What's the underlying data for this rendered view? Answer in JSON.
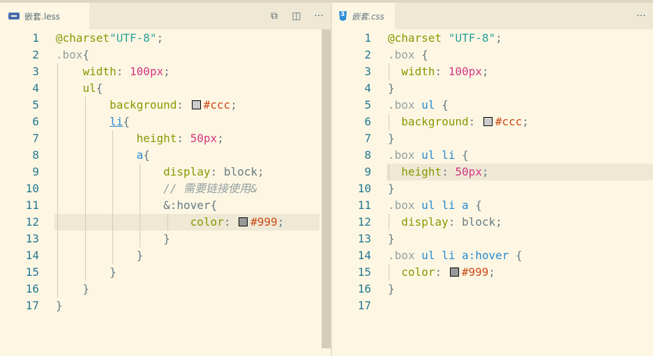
{
  "left_editor": {
    "tab_label": "嵌套.less",
    "actions": {
      "compare_icon": "⧉",
      "split_icon": "◫",
      "more_icon": "···"
    },
    "line_numbers": [
      "1",
      "2",
      "3",
      "4",
      "5",
      "6",
      "7",
      "8",
      "9",
      "10",
      "11",
      "12",
      "13",
      "14",
      "15",
      "16",
      "17"
    ],
    "lines": [
      [
        {
          "t": "@charset",
          "c": "at"
        },
        {
          "t": "\"UTF-8\"",
          "c": "str"
        },
        {
          "t": ";",
          "c": "plain"
        }
      ],
      [
        {
          "t": ".box",
          "c": "sel"
        },
        {
          "t": "{",
          "c": "plain"
        }
      ],
      [
        {
          "t": "    ",
          "c": "plain"
        },
        {
          "t": "width",
          "c": "prop"
        },
        {
          "t": ": ",
          "c": "plain"
        },
        {
          "t": "100px",
          "c": "num"
        },
        {
          "t": ";",
          "c": "plain"
        }
      ],
      [
        {
          "t": "    ",
          "c": "plain"
        },
        {
          "t": "ul",
          "c": "kw"
        },
        {
          "t": "{",
          "c": "plain"
        }
      ],
      [
        {
          "t": "        ",
          "c": "plain"
        },
        {
          "t": "background",
          "c": "prop"
        },
        {
          "t": ": ",
          "c": "plain"
        },
        {
          "t": "",
          "c": "swatch",
          "color": "#CCCCCC"
        },
        {
          "t": "#ccc",
          "c": "hash"
        },
        {
          "t": ";",
          "c": "plain"
        }
      ],
      [
        {
          "t": "        ",
          "c": "plain"
        },
        {
          "t": "li",
          "c": "ul"
        },
        {
          "t": "{",
          "c": "plain"
        }
      ],
      [
        {
          "t": "            ",
          "c": "plain"
        },
        {
          "t": "height",
          "c": "prop"
        },
        {
          "t": ": ",
          "c": "plain"
        },
        {
          "t": "50px",
          "c": "num"
        },
        {
          "t": ";",
          "c": "plain"
        }
      ],
      [
        {
          "t": "            ",
          "c": "plain"
        },
        {
          "t": "a",
          "c": "tag"
        },
        {
          "t": "{",
          "c": "plain"
        }
      ],
      [
        {
          "t": "                ",
          "c": "plain"
        },
        {
          "t": "display",
          "c": "prop"
        },
        {
          "t": ": ",
          "c": "plain"
        },
        {
          "t": "block",
          "c": "plain"
        },
        {
          "t": ";",
          "c": "plain"
        }
      ],
      [
        {
          "t": "                ",
          "c": "plain"
        },
        {
          "t": "// 需要链接使用&",
          "c": "cm"
        }
      ],
      [
        {
          "t": "                ",
          "c": "plain"
        },
        {
          "t": "&:hover",
          "c": "plain"
        },
        {
          "t": "{",
          "c": "plain"
        }
      ],
      [
        {
          "t": "                    ",
          "c": "plain"
        },
        {
          "t": "color",
          "c": "prop"
        },
        {
          "t": ": ",
          "c": "plain"
        },
        {
          "t": "",
          "c": "swatch",
          "color": "#999999"
        },
        {
          "t": "#999",
          "c": "hash"
        },
        {
          "t": ";",
          "c": "plain"
        }
      ],
      [
        {
          "t": "                ",
          "c": "plain"
        },
        {
          "t": "}",
          "c": "plain"
        }
      ],
      [
        {
          "t": "            ",
          "c": "plain"
        },
        {
          "t": "}",
          "c": "plain"
        }
      ],
      [
        {
          "t": "        ",
          "c": "plain"
        },
        {
          "t": "}",
          "c": "plain"
        }
      ],
      [
        {
          "t": "    ",
          "c": "plain"
        },
        {
          "t": "}",
          "c": "plain"
        }
      ],
      [
        {
          "t": "}",
          "c": "plain"
        }
      ]
    ],
    "highlight_line": 12
  },
  "right_editor": {
    "tab_label": "嵌套.css",
    "actions": {
      "more_icon": "···"
    },
    "line_numbers": [
      "1",
      "2",
      "3",
      "4",
      "5",
      "6",
      "7",
      "8",
      "9",
      "10",
      "11",
      "12",
      "13",
      "14",
      "15",
      "16",
      "17"
    ],
    "lines": [
      [
        {
          "t": "@charset ",
          "c": "at"
        },
        {
          "t": "\"UTF-8\"",
          "c": "str"
        },
        {
          "t": ";",
          "c": "plain"
        }
      ],
      [
        {
          "t": ".box ",
          "c": "sel"
        },
        {
          "t": "{",
          "c": "plain"
        }
      ],
      [
        {
          "t": "  ",
          "c": "plain"
        },
        {
          "t": "width",
          "c": "prop"
        },
        {
          "t": ": ",
          "c": "plain"
        },
        {
          "t": "100px",
          "c": "num"
        },
        {
          "t": ";",
          "c": "plain"
        }
      ],
      [
        {
          "t": "}",
          "c": "plain"
        }
      ],
      [
        {
          "t": ".box ",
          "c": "sel"
        },
        {
          "t": "ul ",
          "c": "tag"
        },
        {
          "t": "{",
          "c": "plain"
        }
      ],
      [
        {
          "t": "  ",
          "c": "plain"
        },
        {
          "t": "background",
          "c": "prop"
        },
        {
          "t": ": ",
          "c": "plain"
        },
        {
          "t": "",
          "c": "swatch",
          "color": "#CCCCCC"
        },
        {
          "t": "#ccc",
          "c": "hash"
        },
        {
          "t": ";",
          "c": "plain"
        }
      ],
      [
        {
          "t": "}",
          "c": "plain"
        }
      ],
      [
        {
          "t": ".box ",
          "c": "sel"
        },
        {
          "t": "ul li ",
          "c": "tag"
        },
        {
          "t": "{",
          "c": "plain"
        }
      ],
      [
        {
          "t": "  ",
          "c": "plain"
        },
        {
          "t": "height",
          "c": "prop"
        },
        {
          "t": ": ",
          "c": "plain"
        },
        {
          "t": "50px",
          "c": "num"
        },
        {
          "t": ";",
          "c": "plain"
        }
      ],
      [
        {
          "t": "}",
          "c": "plain"
        }
      ],
      [
        {
          "t": ".box ",
          "c": "sel"
        },
        {
          "t": "ul li a ",
          "c": "tag"
        },
        {
          "t": "{",
          "c": "plain"
        }
      ],
      [
        {
          "t": "  ",
          "c": "plain"
        },
        {
          "t": "display",
          "c": "prop"
        },
        {
          "t": ": ",
          "c": "plain"
        },
        {
          "t": "block",
          "c": "plain"
        },
        {
          "t": ";",
          "c": "plain"
        }
      ],
      [
        {
          "t": "}",
          "c": "plain"
        }
      ],
      [
        {
          "t": ".box ",
          "c": "sel"
        },
        {
          "t": "ul li a:hover ",
          "c": "tag"
        },
        {
          "t": "{",
          "c": "plain"
        }
      ],
      [
        {
          "t": "  ",
          "c": "plain"
        },
        {
          "t": "color",
          "c": "prop"
        },
        {
          "t": ": ",
          "c": "plain"
        },
        {
          "t": "",
          "c": "swatch",
          "color": "#999999"
        },
        {
          "t": "#999",
          "c": "hash"
        },
        {
          "t": ";",
          "c": "plain"
        }
      ],
      [
        {
          "t": "}",
          "c": "plain"
        }
      ],
      []
    ],
    "highlight_line": 9
  },
  "colors": {
    "background": "#FDF6E3",
    "tabbar": "#EEE8D5",
    "line_number": "#237893",
    "selector": "#93A1A1",
    "property": "#859900",
    "number": "#D33682",
    "string": "#2AA198",
    "tag": "#268BD2",
    "hash": "#CB4B16"
  }
}
